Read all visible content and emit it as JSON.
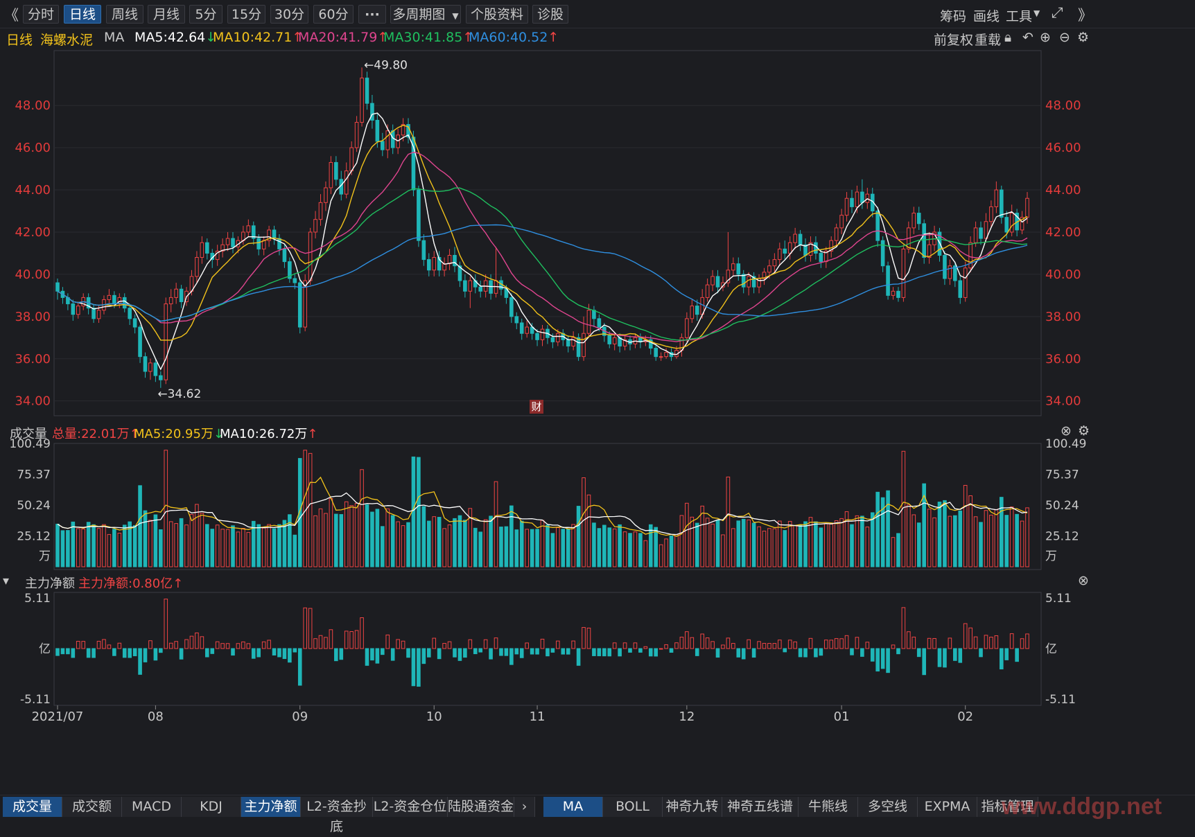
{
  "toolbar": {
    "collapse_icon": "double-chevron-left-icon",
    "periods": [
      "分时",
      "日线",
      "周线",
      "月线",
      "5分",
      "15分",
      "30分",
      "60分"
    ],
    "active_period": "日线",
    "more": "···",
    "multi_period": "多周期图",
    "stock_info": "个股资料",
    "diagnose": "诊股",
    "right": [
      "筹码",
      "画线",
      "工具"
    ],
    "fullscreen_icon": "fullscreen-icon",
    "expand_icon": "double-chevron-right-icon"
  },
  "header": {
    "period": "日线",
    "stock_name": "海螺水泥",
    "indicator": "MA",
    "ma5": "MA5:42.64",
    "ma10": "MA10:42.71",
    "ma20": "MA20:41.79",
    "ma30": "MA30:41.85",
    "ma60": "MA60:40.52",
    "adjust": "前复权",
    "reload": "重载"
  },
  "colors": {
    "up": "#ef4444",
    "down": "#1fb6b8",
    "ma5": "#ffffff",
    "ma10": "#f2c21b",
    "ma20": "#e0458f",
    "ma30": "#1fbf5f",
    "ma60": "#2f8fe0",
    "axis": "#e23b3b"
  },
  "volume_panel": {
    "title": "成交量",
    "total": "总量:22.01万",
    "ma5": "MA5:20.95万",
    "ma10": "MA10:26.72万",
    "unit": "万",
    "ticks": [
      "100.49",
      "75.37",
      "50.24",
      "25.12"
    ]
  },
  "flow_panel": {
    "title": "主力净额",
    "value": "主力净额:0.80亿",
    "unit": "亿",
    "ticks": [
      "5.11",
      "-5.11"
    ]
  },
  "bottom_tabs_left": [
    "成交量",
    "成交额",
    "MACD",
    "KDJ",
    "主力净额",
    "L2-资金抄底",
    "L2-资金仓位",
    "陆股通资金"
  ],
  "bottom_tabs_right": [
    "MA",
    "BOLL",
    "神奇九转",
    "神奇五线谱",
    "牛熊线",
    "多空线",
    "EXPMA",
    "指标管理"
  ],
  "active_bottom_left": [
    "成交量",
    "主力净额"
  ],
  "active_bottom_right": "MA",
  "finance_marker": "财",
  "watermark": "www.ddgp.net",
  "chart_data": {
    "type": "candlestick",
    "price_ticks": [
      "48.00",
      "46.00",
      "44.00",
      "42.00",
      "40.00",
      "38.00",
      "36.00",
      "34.00"
    ],
    "ylim": [
      33.3,
      50.6
    ],
    "x_labels": [
      "2021/07",
      "08",
      "09",
      "10",
      "11",
      "12",
      "01",
      "02"
    ],
    "x_label_index": [
      0,
      19,
      47,
      73,
      93,
      122,
      152,
      176
    ],
    "annotations": [
      {
        "text": "←49.80",
        "index": 59,
        "value": 49.8
      },
      {
        "text": "←34.62",
        "index": 19,
        "value": 34.62
      }
    ],
    "candles": [
      [
        39.6,
        39.2,
        39.8,
        38.8
      ],
      [
        39.2,
        38.9,
        39.4,
        38.6
      ],
      [
        38.9,
        38.6,
        39.1,
        38.3
      ],
      [
        38.6,
        38.1,
        38.8,
        37.8
      ],
      [
        38.1,
        38.5,
        38.7,
        37.9
      ],
      [
        38.5,
        38.9,
        39.1,
        38.3
      ],
      [
        38.9,
        38.4,
        39.1,
        38.1
      ],
      [
        38.4,
        37.9,
        38.6,
        37.7
      ],
      [
        37.9,
        38.3,
        38.5,
        37.7
      ],
      [
        38.3,
        38.8,
        39.0,
        38.1
      ],
      [
        38.8,
        39.0,
        39.3,
        38.6
      ],
      [
        39.0,
        38.6,
        39.2,
        38.4
      ],
      [
        38.6,
        38.9,
        39.1,
        38.4
      ],
      [
        38.9,
        38.4,
        39.1,
        38.2
      ],
      [
        38.4,
        37.9,
        38.6,
        37.6
      ],
      [
        37.9,
        37.5,
        38.1,
        37.2
      ],
      [
        37.5,
        36.1,
        37.6,
        35.8
      ],
      [
        36.1,
        35.4,
        36.3,
        35.1
      ],
      [
        35.4,
        35.8,
        36.0,
        35.0
      ],
      [
        35.8,
        35.2,
        36.0,
        34.9
      ],
      [
        35.2,
        35.0,
        35.4,
        34.62
      ],
      [
        35.0,
        38.6,
        38.9,
        34.8
      ],
      [
        38.6,
        38.9,
        39.3,
        38.2
      ],
      [
        38.9,
        39.3,
        39.6,
        38.6
      ],
      [
        39.3,
        38.7,
        39.5,
        38.4
      ],
      [
        38.7,
        39.2,
        39.4,
        38.5
      ],
      [
        39.2,
        39.9,
        40.2,
        39.0
      ],
      [
        39.9,
        40.8,
        41.1,
        39.6
      ],
      [
        40.8,
        41.5,
        41.8,
        40.5
      ],
      [
        41.5,
        41.0,
        41.7,
        40.7
      ],
      [
        41.0,
        40.7,
        41.2,
        40.3
      ],
      [
        40.7,
        41.1,
        41.4,
        40.4
      ],
      [
        41.1,
        41.4,
        41.7,
        40.8
      ],
      [
        41.4,
        41.7,
        42.0,
        41.1
      ],
      [
        41.7,
        41.3,
        42.0,
        41.0
      ],
      [
        41.3,
        41.6,
        41.8,
        41.0
      ],
      [
        41.6,
        42.0,
        42.3,
        41.4
      ],
      [
        42.0,
        42.3,
        42.6,
        41.8
      ],
      [
        42.3,
        41.7,
        42.5,
        41.4
      ],
      [
        41.7,
        41.2,
        41.9,
        40.9
      ],
      [
        41.2,
        41.6,
        41.8,
        40.9
      ],
      [
        41.6,
        42.1,
        42.3,
        41.3
      ],
      [
        42.1,
        41.7,
        42.3,
        41.4
      ],
      [
        41.7,
        41.2,
        41.9,
        40.9
      ],
      [
        41.2,
        40.6,
        41.4,
        40.3
      ],
      [
        40.6,
        39.8,
        40.8,
        39.6
      ],
      [
        39.8,
        39.6,
        40.0,
        39.3
      ],
      [
        39.6,
        37.5,
        39.8,
        37.2
      ],
      [
        37.5,
        39.7,
        40.0,
        37.3
      ],
      [
        39.7,
        42.0,
        42.2,
        39.5
      ],
      [
        42.0,
        42.6,
        43.0,
        41.7
      ],
      [
        42.6,
        43.4,
        43.8,
        42.3
      ],
      [
        43.4,
        44.1,
        44.4,
        43.0
      ],
      [
        44.1,
        45.3,
        45.6,
        43.8
      ],
      [
        45.3,
        44.5,
        45.6,
        44.2
      ],
      [
        44.5,
        43.8,
        44.9,
        43.5
      ],
      [
        43.8,
        44.9,
        45.3,
        43.6
      ],
      [
        44.9,
        46.0,
        46.3,
        44.7
      ],
      [
        46.0,
        47.2,
        47.5,
        45.8
      ],
      [
        47.2,
        49.3,
        49.8,
        47.0
      ],
      [
        49.3,
        48.1,
        49.6,
        47.8
      ],
      [
        48.1,
        47.3,
        48.5,
        46.9
      ],
      [
        47.3,
        46.3,
        47.6,
        46.0
      ],
      [
        46.3,
        45.9,
        46.7,
        45.6
      ],
      [
        45.9,
        46.8,
        47.1,
        45.5
      ],
      [
        46.8,
        46.0,
        47.1,
        45.7
      ],
      [
        46.0,
        46.6,
        46.9,
        45.7
      ],
      [
        46.6,
        47.1,
        47.4,
        46.3
      ],
      [
        47.1,
        46.5,
        47.4,
        46.2
      ],
      [
        46.5,
        44.0,
        46.8,
        43.7
      ],
      [
        44.0,
        41.6,
        44.2,
        41.3
      ],
      [
        41.6,
        40.7,
        41.9,
        40.4
      ],
      [
        40.7,
        40.2,
        41.0,
        39.9
      ],
      [
        40.2,
        40.8,
        41.1,
        39.9
      ],
      [
        40.8,
        40.2,
        41.1,
        39.9
      ],
      [
        40.2,
        40.5,
        40.8,
        39.9
      ],
      [
        40.5,
        40.9,
        41.2,
        40.2
      ],
      [
        40.9,
        40.4,
        41.3,
        40.1
      ],
      [
        40.4,
        39.7,
        40.6,
        39.4
      ],
      [
        39.7,
        39.2,
        40.0,
        38.9
      ],
      [
        39.2,
        39.7,
        39.9,
        38.4
      ],
      [
        39.7,
        39.4,
        40.0,
        39.1
      ],
      [
        39.4,
        39.2,
        39.7,
        38.9
      ],
      [
        39.2,
        39.7,
        40.0,
        38.9
      ],
      [
        39.7,
        39.1,
        40.0,
        38.8
      ],
      [
        39.1,
        39.7,
        41.3,
        38.9
      ],
      [
        39.7,
        39.3,
        39.9,
        39.0
      ],
      [
        39.3,
        38.9,
        39.5,
        38.6
      ],
      [
        38.9,
        38.0,
        39.1,
        37.7
      ],
      [
        38.0,
        37.7,
        38.2,
        37.4
      ],
      [
        37.7,
        37.2,
        37.9,
        36.9
      ],
      [
        37.2,
        37.5,
        37.8,
        37.0
      ],
      [
        37.5,
        37.2,
        37.7,
        36.9
      ],
      [
        37.2,
        36.9,
        37.4,
        36.6
      ],
      [
        36.9,
        37.4,
        37.6,
        36.6
      ],
      [
        37.4,
        37.0,
        37.6,
        36.7
      ],
      [
        37.0,
        36.8,
        37.2,
        36.5
      ],
      [
        36.8,
        37.2,
        37.4,
        36.6
      ],
      [
        37.2,
        36.9,
        37.4,
        36.6
      ],
      [
        36.9,
        36.6,
        37.1,
        36.3
      ],
      [
        36.6,
        37.0,
        37.3,
        36.4
      ],
      [
        37.0,
        36.1,
        37.2,
        35.9
      ],
      [
        36.1,
        37.2,
        38.0,
        35.9
      ],
      [
        37.2,
        38.3,
        38.6,
        37.0
      ],
      [
        38.3,
        37.9,
        38.5,
        37.5
      ],
      [
        37.9,
        37.5,
        38.1,
        37.3
      ],
      [
        37.5,
        37.1,
        37.7,
        36.8
      ],
      [
        37.1,
        36.7,
        37.3,
        36.5
      ],
      [
        36.7,
        37.0,
        37.2,
        36.4
      ],
      [
        37.0,
        36.6,
        37.2,
        36.3
      ],
      [
        36.6,
        36.9,
        37.1,
        36.4
      ],
      [
        36.9,
        36.7,
        37.1,
        36.4
      ],
      [
        36.7,
        37.0,
        37.2,
        36.5
      ],
      [
        37.0,
        36.8,
        37.2,
        36.5
      ],
      [
        36.8,
        36.9,
        37.1,
        36.6
      ],
      [
        36.9,
        36.5,
        37.1,
        36.2
      ],
      [
        36.5,
        36.1,
        36.7,
        35.9
      ],
      [
        36.1,
        36.1,
        36.3,
        35.9
      ],
      [
        36.1,
        36.3,
        36.5,
        36.0
      ],
      [
        36.3,
        36.1,
        36.5,
        35.9
      ],
      [
        36.1,
        36.4,
        36.6,
        36.0
      ],
      [
        36.4,
        37.0,
        37.2,
        36.1
      ],
      [
        37.0,
        37.9,
        38.2,
        36.8
      ],
      [
        37.9,
        38.5,
        38.8,
        37.7
      ],
      [
        38.5,
        38.1,
        38.8,
        37.8
      ],
      [
        38.1,
        38.9,
        39.3,
        37.9
      ],
      [
        38.9,
        39.5,
        39.8,
        38.7
      ],
      [
        39.5,
        39.9,
        40.2,
        39.2
      ],
      [
        39.9,
        39.4,
        40.2,
        39.1
      ],
      [
        39.4,
        39.6,
        39.9,
        39.2
      ],
      [
        39.6,
        40.2,
        42.0,
        39.4
      ],
      [
        40.2,
        40.5,
        40.8,
        39.9
      ],
      [
        40.5,
        40.0,
        40.8,
        39.7
      ],
      [
        40.0,
        39.4,
        40.2,
        39.1
      ],
      [
        39.4,
        39.9,
        40.1,
        39.0
      ],
      [
        39.9,
        39.4,
        40.1,
        39.1
      ],
      [
        39.4,
        39.8,
        40.0,
        39.1
      ],
      [
        39.8,
        40.1,
        40.3,
        39.5
      ],
      [
        40.1,
        40.4,
        40.7,
        39.8
      ],
      [
        40.4,
        40.7,
        41.0,
        40.1
      ],
      [
        40.7,
        41.2,
        41.5,
        40.4
      ],
      [
        41.2,
        41.0,
        41.6,
        40.7
      ],
      [
        41.0,
        41.5,
        41.8,
        40.7
      ],
      [
        41.5,
        41.9,
        42.2,
        41.2
      ],
      [
        41.9,
        41.4,
        42.1,
        41.1
      ],
      [
        41.4,
        40.9,
        41.7,
        40.6
      ],
      [
        40.9,
        41.5,
        41.8,
        40.6
      ],
      [
        41.5,
        41.0,
        41.8,
        40.7
      ],
      [
        41.0,
        40.6,
        41.2,
        40.3
      ],
      [
        40.6,
        41.1,
        41.3,
        40.3
      ],
      [
        41.1,
        41.6,
        41.8,
        40.8
      ],
      [
        41.6,
        42.2,
        42.4,
        41.3
      ],
      [
        42.2,
        42.8,
        43.1,
        41.9
      ],
      [
        42.8,
        43.6,
        43.9,
        42.5
      ],
      [
        43.6,
        43.2,
        44.0,
        42.9
      ],
      [
        43.2,
        43.9,
        44.2,
        42.9
      ],
      [
        43.9,
        43.4,
        44.5,
        43.1
      ],
      [
        43.4,
        43.8,
        44.1,
        43.1
      ],
      [
        43.8,
        43.0,
        44.1,
        42.7
      ],
      [
        43.0,
        41.6,
        43.2,
        41.3
      ],
      [
        41.6,
        40.4,
        41.8,
        40.1
      ],
      [
        40.4,
        39.0,
        40.6,
        38.8
      ],
      [
        39.0,
        39.2,
        39.4,
        38.8
      ],
      [
        39.2,
        38.9,
        39.4,
        38.7
      ],
      [
        38.9,
        41.2,
        41.4,
        38.7
      ],
      [
        41.2,
        42.2,
        42.5,
        41.0
      ],
      [
        42.2,
        42.9,
        43.2,
        41.9
      ],
      [
        42.9,
        42.4,
        43.2,
        42.1
      ],
      [
        42.4,
        40.8,
        42.6,
        40.5
      ],
      [
        40.8,
        41.4,
        42.0,
        40.5
      ],
      [
        41.4,
        42.0,
        42.3,
        41.1
      ],
      [
        42.0,
        40.9,
        42.2,
        40.6
      ],
      [
        40.9,
        39.8,
        41.1,
        39.5
      ],
      [
        39.8,
        40.4,
        40.7,
        39.5
      ],
      [
        40.4,
        39.7,
        40.6,
        39.4
      ],
      [
        39.7,
        38.9,
        39.9,
        38.6
      ],
      [
        38.9,
        40.3,
        40.6,
        38.7
      ],
      [
        40.3,
        41.5,
        41.8,
        40.1
      ],
      [
        41.5,
        42.2,
        42.5,
        41.3
      ],
      [
        42.2,
        41.7,
        42.5,
        41.4
      ],
      [
        41.7,
        42.5,
        42.9,
        41.5
      ],
      [
        42.5,
        43.2,
        43.5,
        42.2
      ],
      [
        43.2,
        44.0,
        44.4,
        42.9
      ],
      [
        44.0,
        42.7,
        44.2,
        42.4
      ],
      [
        42.7,
        42.0,
        43.0,
        41.7
      ],
      [
        42.0,
        42.9,
        43.3,
        41.8
      ],
      [
        42.9,
        42.1,
        43.1,
        41.8
      ],
      [
        42.1,
        42.7,
        43.0,
        41.9
      ],
      [
        42.7,
        43.6,
        43.9,
        42.4
      ]
    ]
  }
}
